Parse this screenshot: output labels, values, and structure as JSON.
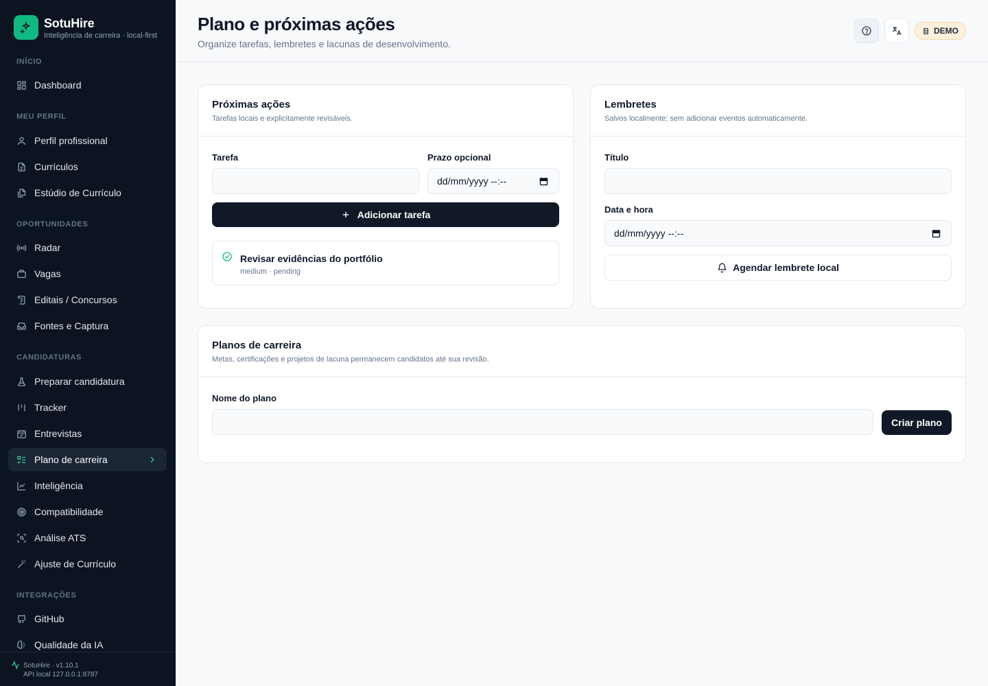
{
  "brand": {
    "name": "SotuHire",
    "subtitle": "Inteligência de carreira · local-first"
  },
  "sidebar": {
    "sections": [
      {
        "title": "INÍCIO"
      },
      {
        "title": "MEU PERFIL"
      },
      {
        "title": "OPORTUNIDADES"
      },
      {
        "title": "CANDIDATURAS"
      },
      {
        "title": "INTEGRAÇÕES"
      }
    ],
    "items": [
      {
        "label": "Dashboard",
        "icon": "dashboard-icon"
      },
      {
        "label": "Perfil profissional",
        "icon": "user-icon"
      },
      {
        "label": "Currículos",
        "icon": "file-icon"
      },
      {
        "label": "Estúdio de Currículo",
        "icon": "files-icon"
      },
      {
        "label": "Radar",
        "icon": "radar-icon"
      },
      {
        "label": "Vagas",
        "icon": "briefcase-icon"
      },
      {
        "label": "Editais / Concursos",
        "icon": "scroll-icon"
      },
      {
        "label": "Fontes e Captura",
        "icon": "inbox-icon"
      },
      {
        "label": "Preparar candidatura",
        "icon": "flask-icon"
      },
      {
        "label": "Tracker",
        "icon": "kanban-icon"
      },
      {
        "label": "Entrevistas",
        "icon": "calendar-check-icon"
      },
      {
        "label": "Plano de carreira",
        "icon": "list-todo-icon",
        "active": true
      },
      {
        "label": "Inteligência",
        "icon": "line-chart-icon"
      },
      {
        "label": "Compatibilidade",
        "icon": "target-icon"
      },
      {
        "label": "Análise ATS",
        "icon": "scan-icon"
      },
      {
        "label": "Ajuste de Currículo",
        "icon": "wand-icon"
      },
      {
        "label": "GitHub",
        "icon": "github-icon"
      },
      {
        "label": "Qualidade da IA",
        "icon": "brain-icon"
      }
    ],
    "footer": {
      "version": "SotuHire · v1.10.1",
      "api": "API local 127.0.0.1:8787"
    }
  },
  "header": {
    "title": "Plano e próximas ações",
    "subtitle": "Organize tarefas, lembretes e lacunas de desenvolvimento.",
    "demo_label": "DEMO"
  },
  "next_actions": {
    "title": "Próximas ações",
    "description": "Tarefas locais e explicitamente revisáveis.",
    "task_label": "Tarefa",
    "task_value": "",
    "deadline_label": "Prazo opcional",
    "deadline_value": "dd/mm/yyyy --:--",
    "add_button": "Adicionar tarefa",
    "tasks": [
      {
        "title": "Revisar evidências do portfólio",
        "meta": "medium · pending"
      }
    ]
  },
  "reminders": {
    "title": "Lembretes",
    "description": "Salvos localmente; sem adicionar eventos automaticamente.",
    "title_label": "Título",
    "title_value": "",
    "datetime_label": "Data e hora",
    "datetime_value": "dd/mm/yyyy --:--",
    "schedule_button": "Agendar lembrete local"
  },
  "career_plans": {
    "title": "Planos de carreira",
    "description": "Metas, certificações e projetos de lacuna permanecem candidatos até sua revisão.",
    "name_label": "Nome do plano",
    "name_value": "",
    "create_button": "Criar plano"
  },
  "colors": {
    "accent": "#10b981",
    "sidebar_bg": "#0b1420",
    "primary_btn": "#111827",
    "demo_bg": "#fdf0dc"
  }
}
